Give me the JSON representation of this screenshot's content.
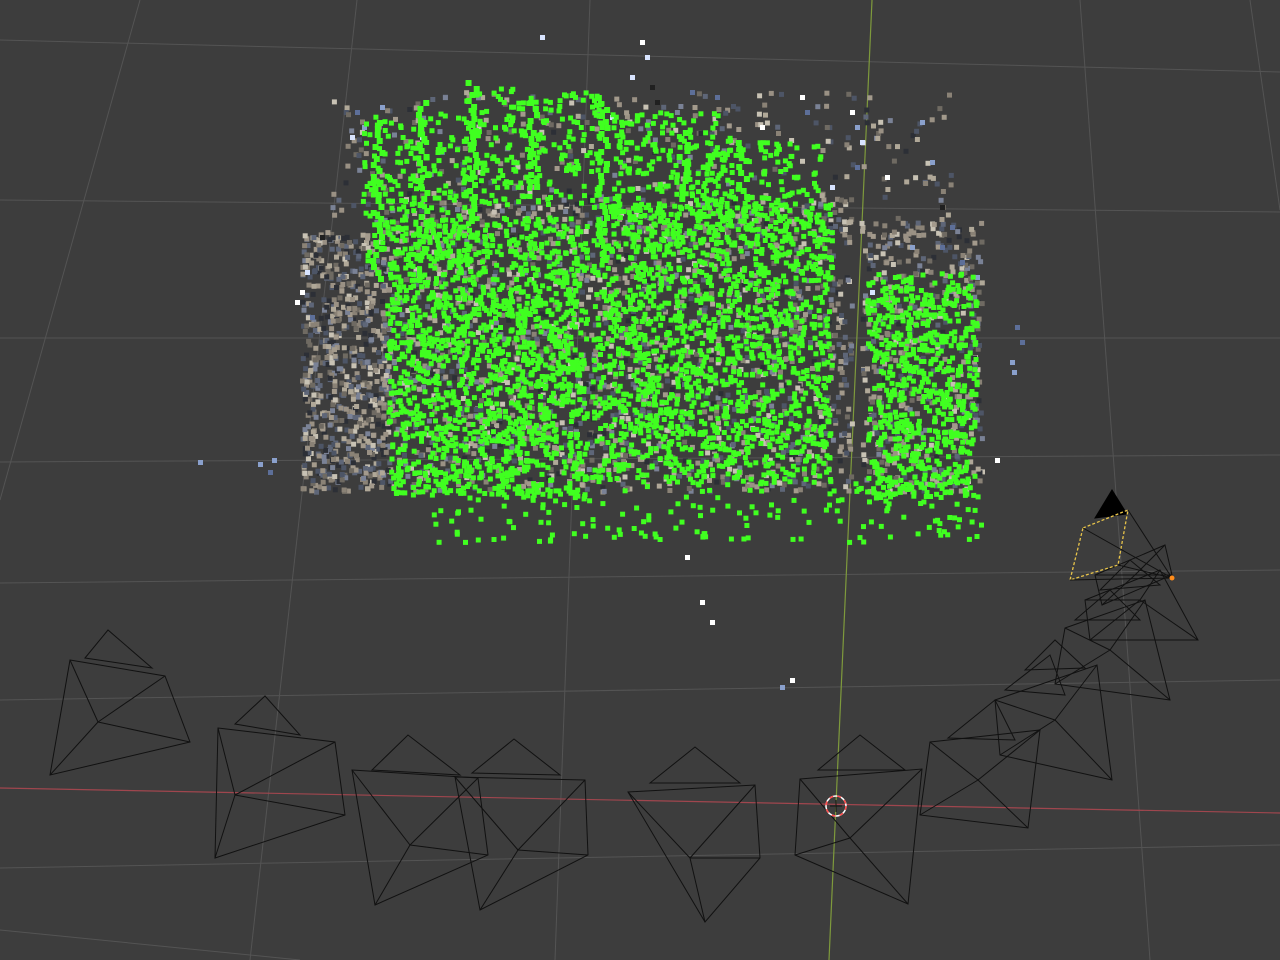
{
  "viewport": {
    "background": "#3d3d3d",
    "grid_color": "#545454",
    "x_axis_color": "#a0464e",
    "y_axis_color": "#7e9a3c",
    "camera_color": "#111111",
    "selected_camera_color": "#e8c44a",
    "selected_origin_color": "#ff8c1a",
    "cursor_colors": [
      "#ff4b4b",
      "#ffffff"
    ],
    "highlight_points_color": "#40ff20",
    "point_palette": [
      "#8a8276",
      "#9a9184",
      "#6f6a62",
      "#5e6678",
      "#7a8296",
      "#a39a8c",
      "#4d5566",
      "#b0a898",
      "#c8c2b4",
      "#2c2f36"
    ],
    "sparse_point_colors": [
      "#ffffff",
      "#d8e4ff",
      "#8aa0cc",
      "#5d6f99",
      "#202020"
    ],
    "camera_count": 14
  }
}
